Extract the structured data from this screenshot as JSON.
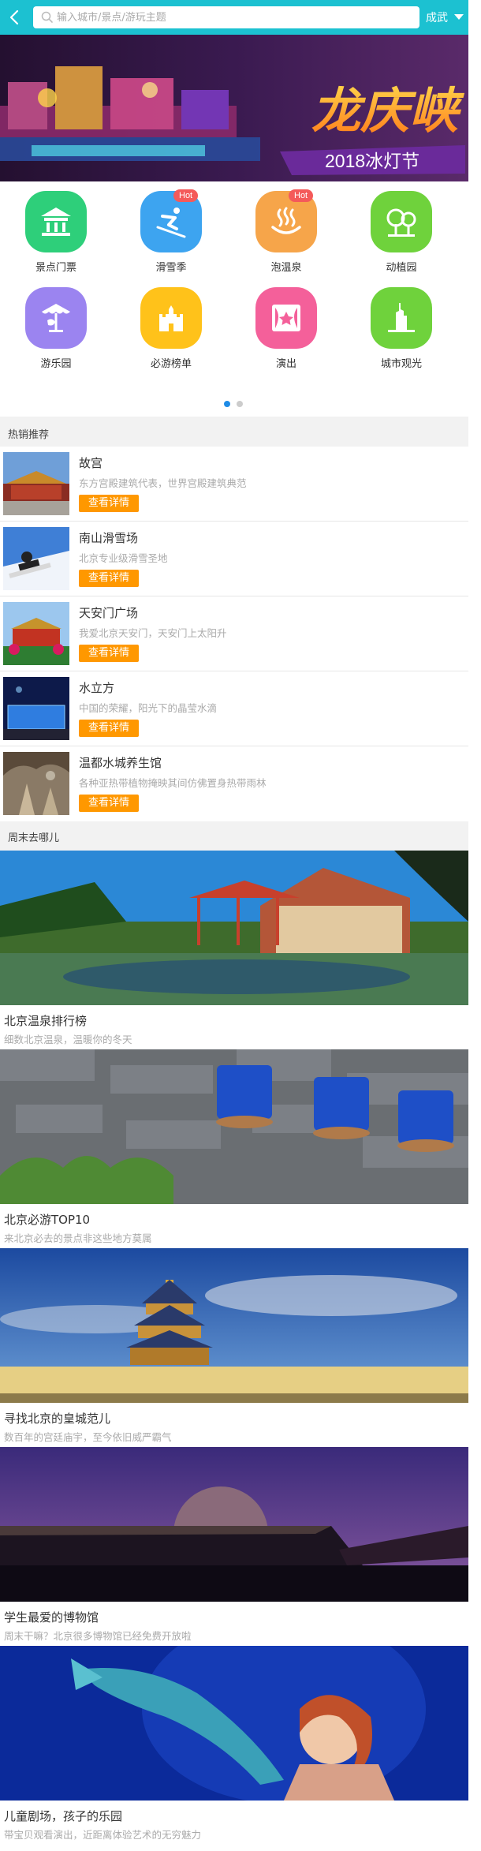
{
  "search": {
    "placeholder": "输入城市/景点/游玩主题"
  },
  "city": "成武",
  "banner": {
    "title": "龙庆峡",
    "subtitle": "2018冰灯节"
  },
  "categories": [
    {
      "label": "景点门票",
      "icon": "temple-icon",
      "color": "#2ecf7a"
    },
    {
      "label": "滑雪季",
      "icon": "skier-icon",
      "color": "#3da4f0",
      "badge": "Hot"
    },
    {
      "label": "泡温泉",
      "icon": "hot-spring-icon",
      "color": "#f6a54a",
      "badge": "Hot"
    },
    {
      "label": "动植园",
      "icon": "tree-icon",
      "color": "#6fd23c"
    },
    {
      "label": "游乐园",
      "icon": "carousel-icon",
      "color": "#9b84f0"
    },
    {
      "label": "必游榜单",
      "icon": "castle-icon",
      "color": "#ffc21a"
    },
    {
      "label": "演出",
      "icon": "theater-icon",
      "color": "#f4609a"
    },
    {
      "label": "城市观光",
      "icon": "tower-icon",
      "color": "#6fd23c"
    }
  ],
  "pager": {
    "pages": 2,
    "active": 1,
    "active_color": "#1e8be6",
    "inactive_color": "#cccccc"
  },
  "hot_section": {
    "title": "热销推荐"
  },
  "hot_items": [
    {
      "title": "故宫",
      "desc": "东方宫殿建筑代表，世界宫殿建筑典范",
      "button": "查看详情"
    },
    {
      "title": "南山滑雪场",
      "desc": "北京专业级滑雪圣地",
      "button": "查看详情"
    },
    {
      "title": "天安门广场",
      "desc": "我爱北京天安门，天安门上太阳升",
      "button": "查看详情"
    },
    {
      "title": "水立方",
      "desc": "中国的荣耀，阳光下的晶莹水滴",
      "button": "查看详情"
    },
    {
      "title": "温都水城养生馆",
      "desc": "各种亚热带植物掩映其间仿佛置身热带雨林",
      "button": "查看详情"
    }
  ],
  "weekend_section": {
    "title": "周末去哪儿"
  },
  "weekend_items": [
    {
      "title": "北京温泉排行榜",
      "subtitle": "细数北京温泉，温暖你的冬天"
    },
    {
      "title": "北京必游TOP10",
      "subtitle": "来北京必去的景点非这些地方莫属"
    },
    {
      "title": "寻找北京的皇城范儿",
      "subtitle": "数百年的宫廷庙宇，至今依旧威严霸气"
    },
    {
      "title": "学生最爱的博物馆",
      "subtitle": "周末干嘛？北京很多博物馆已经免费开放啦"
    },
    {
      "title": "儿童剧场，孩子的乐园",
      "subtitle": "带宝贝观看演出，近距离体验艺术的无穷魅力"
    }
  ],
  "colors": {
    "header": "#1cc1d1",
    "button": "#ff9800",
    "hot_badge": "#f45a5a"
  }
}
